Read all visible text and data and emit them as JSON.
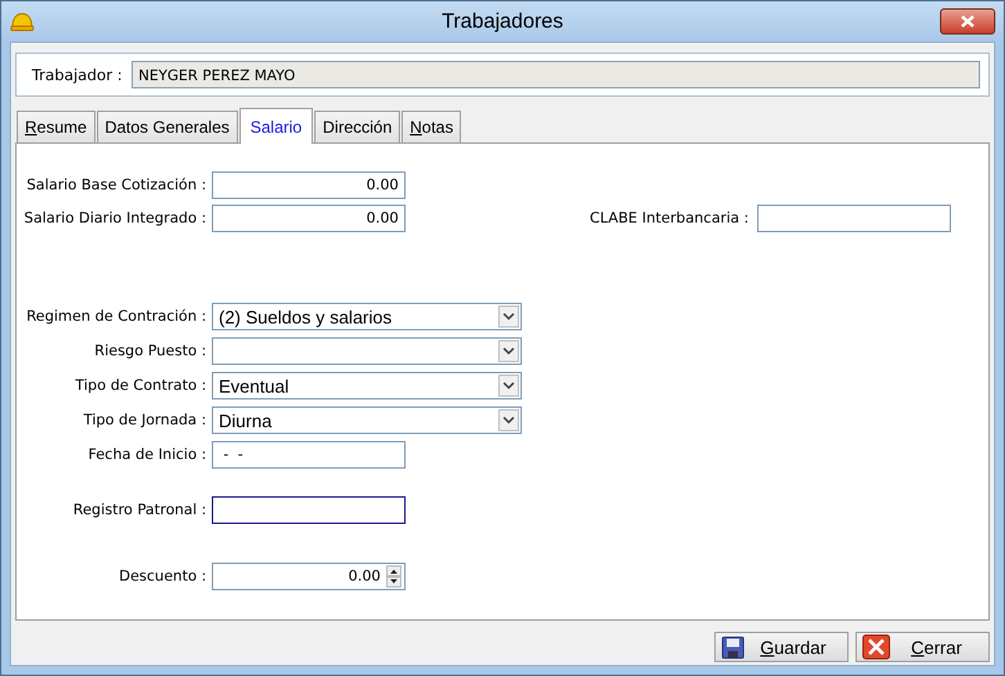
{
  "window": {
    "title": "Trabajadores"
  },
  "trabajador": {
    "label": "Trabajador :",
    "value": "NEYGER PEREZ MAYO"
  },
  "tabs": [
    {
      "label": "Resume",
      "selected": false,
      "mnemonic": true
    },
    {
      "label": "Datos Generales",
      "selected": false,
      "mnemonic": false
    },
    {
      "label": "Salario",
      "selected": true,
      "mnemonic": false
    },
    {
      "label": "Dirección",
      "selected": false,
      "mnemonic": false
    },
    {
      "label": "Notas",
      "selected": false,
      "mnemonic": true
    }
  ],
  "fields": [
    {
      "label": "Salario Base Cotización :",
      "kind": "number",
      "value": "0.00",
      "focused": false
    },
    {
      "label": "Salario Diario Integrado :",
      "kind": "number",
      "value": "0.00",
      "focused": false,
      "beside": {
        "label": "CLABE Interbancaria :",
        "kind": "text",
        "focused": false
      }
    },
    {
      "label": "Regimen de Contración :",
      "kind": "combo",
      "value": "(2) Sueldos y salarios",
      "focused": false
    },
    {
      "label": "Riesgo Puesto :",
      "kind": "combo",
      "focused": false
    },
    {
      "label": "Tipo de Contrato :",
      "kind": "combo",
      "value": "Eventual",
      "focused": false
    },
    {
      "label": "Tipo de Jornada :",
      "kind": "combo",
      "value": "Diurna",
      "focused": false
    },
    {
      "label": "Fecha de Inicio :",
      "kind": "date",
      "value": " -  -",
      "focused": false
    },
    {
      "label": "Registro Patronal :",
      "kind": "text",
      "focused": true
    },
    {
      "label": "Descuento :",
      "kind": "spin",
      "value": "0.00",
      "focused": false
    }
  ],
  "buttons": [
    {
      "label": "Guardar",
      "kind": "save",
      "mnemonic": true
    },
    {
      "label": "Cerrar",
      "kind": "close",
      "mnemonic": true
    }
  ]
}
